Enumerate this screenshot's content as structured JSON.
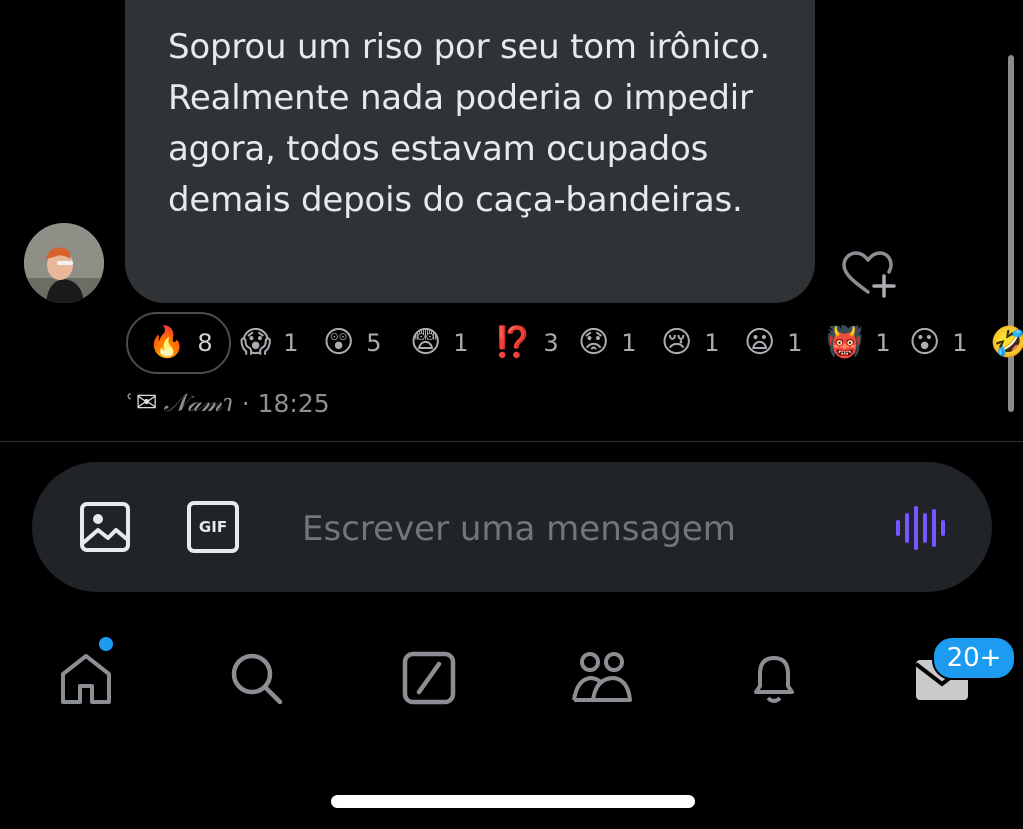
{
  "message": {
    "text": "Soprou um riso por seu tom irônico. Realmente nada poderia o impedir agora, todos estavam ocupados demais depois do caça-bandeiras."
  },
  "reactions": [
    {
      "emoji": "🔥",
      "count": "8",
      "active": true
    },
    {
      "emoji": "😱",
      "count": "1"
    },
    {
      "emoji": "😲",
      "count": "5"
    },
    {
      "emoji": "😨",
      "count": "1"
    },
    {
      "emoji": "⁉️",
      "count": "3"
    },
    {
      "emoji": "😟",
      "count": "1"
    },
    {
      "emoji": "😢",
      "count": "1"
    },
    {
      "emoji": "😦",
      "count": "1"
    },
    {
      "emoji": "👹",
      "count": "1"
    },
    {
      "emoji": "😮",
      "count": "1"
    },
    {
      "emoji": "🤣",
      "count": ""
    }
  ],
  "meta": {
    "prefix": "ʿ",
    "envelope": "✉",
    "sender": "𝒩𝒶𝓂ɿ",
    "time": "· 18:25"
  },
  "composer": {
    "placeholder": "Escrever uma mensagem",
    "image_icon": "image-icon",
    "gif_label": "GIF",
    "voice_icon": "voice-waveform-icon",
    "voice_color": "#7856ff"
  },
  "nav": {
    "items": [
      "home-icon",
      "search-icon",
      "grok-icon",
      "communities-icon",
      "notifications-icon",
      "messages-icon"
    ],
    "messages_badge": "20+",
    "accent": "#1d9bf0"
  }
}
